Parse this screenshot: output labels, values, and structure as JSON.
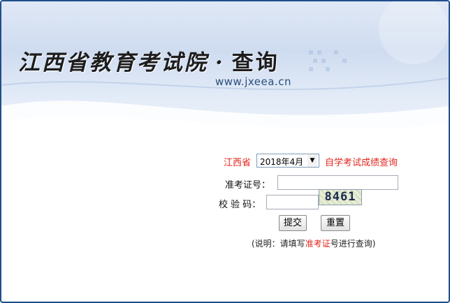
{
  "banner": {
    "title": "江西省教育考试院",
    "separator": "·",
    "subtitle": "查询",
    "url": "www.jxeea.cn"
  },
  "query": {
    "province_label": "江西省",
    "session_select": {
      "selected": "2018年4月"
    },
    "exam_label": "自学考试成绩查询"
  },
  "form": {
    "ticket_label": "准考证号：",
    "ticket_value": "",
    "captcha_label": "校 验 码：",
    "captcha_value": "",
    "captcha_image_text": "8461",
    "submit_label": "提交",
    "reset_label": "重置"
  },
  "note": {
    "prefix": "(说明：请填写",
    "highlight": "准考证",
    "suffix": "号进行查询)"
  },
  "colors": {
    "accent_red": "#e0271e",
    "frame_blue": "#1f4e8c",
    "banner_bg": "#dfe8f6"
  }
}
